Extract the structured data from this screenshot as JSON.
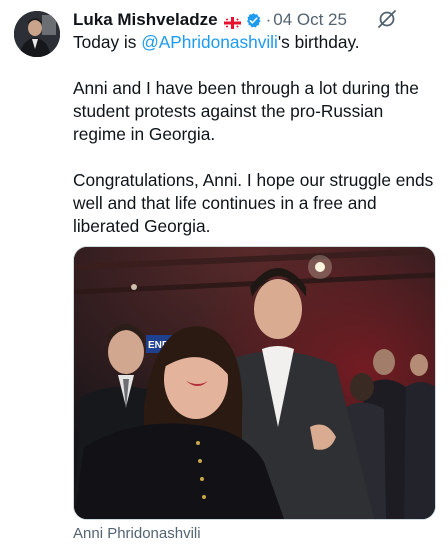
{
  "post": {
    "author_name": "Luka Mishveladze",
    "separator": "·",
    "date": "04 Oct 25",
    "text_prefix": "Today is ",
    "mention": "@APhridonashvili",
    "text_suffix": "'s birthday.",
    "paragraph_2": "Anni and I have been through a lot during the student protests against the pro-Russian regime in Georgia.",
    "paragraph_3": "Congratulations, Anni. I hope our struggle ends well and that life continues in a free and liberated Georgia.",
    "banner_text": "ENBRA",
    "photo_caption": "Anni Phridonashvili"
  },
  "icons": {
    "flag": "georgia-flag-icon",
    "verified": "verified-badge-icon",
    "grok": "grok-icon"
  },
  "colors": {
    "mention": "#1d9bf0",
    "verified": "#1d9bf0",
    "secondary_text": "#536471"
  }
}
